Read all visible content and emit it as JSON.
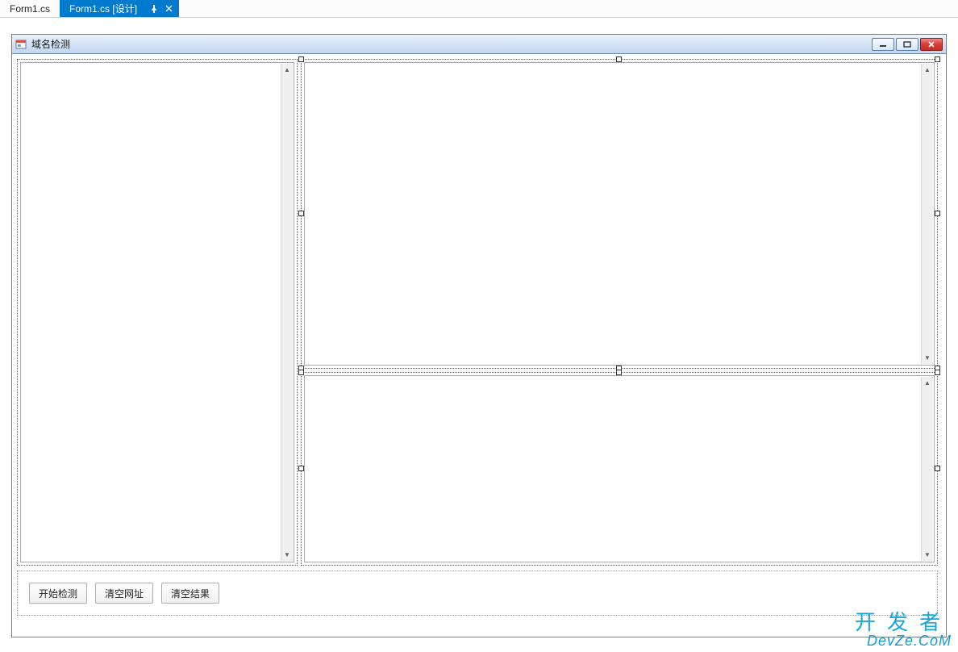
{
  "tabs": {
    "inactive": {
      "label": "Form1.cs"
    },
    "active": {
      "label": "Form1.cs [设计]"
    }
  },
  "form": {
    "title": "域名检测"
  },
  "buttons": {
    "start": "开始检测",
    "clear_urls": "清空网址",
    "clear_results": "清空结果"
  },
  "watermark": {
    "line1": "开发者",
    "line2": "DevZe.CoM"
  },
  "colors": {
    "tab_active_bg": "#007acc",
    "titlebar_grad_top": "#ebf3fb",
    "titlebar_grad_bot": "#c1d6ee",
    "close_red": "#c22d26",
    "watermark": "#1aa5d8"
  }
}
